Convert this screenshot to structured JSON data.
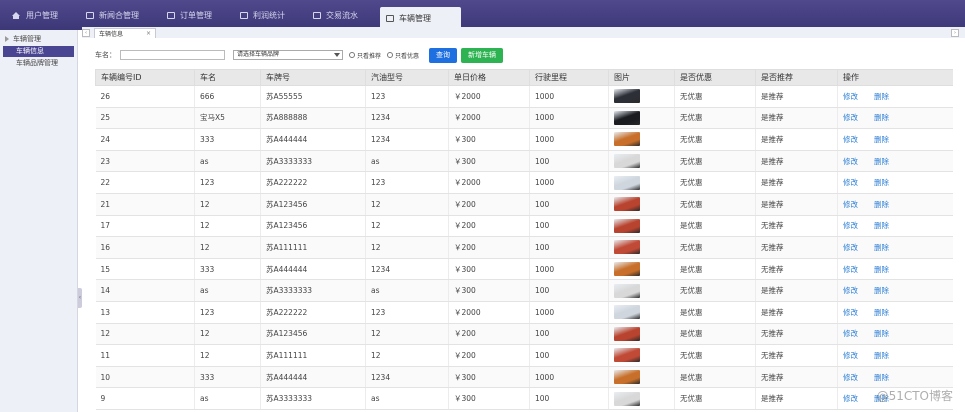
{
  "topnav": [
    {
      "label": "用户管理",
      "icon": "home-icon"
    },
    {
      "label": "新闻合管理",
      "icon": "grid-icon"
    },
    {
      "label": "订单管理",
      "icon": "grid-icon"
    },
    {
      "label": "利润统计",
      "icon": "grid-icon"
    },
    {
      "label": "交易流水",
      "icon": "grid-icon"
    },
    {
      "label": "车辆管理",
      "icon": "grid-icon",
      "active": true
    }
  ],
  "sidebar": {
    "group": "车辆管理",
    "items": [
      {
        "label": "车辆信息",
        "active": true
      },
      {
        "label": "车辆品牌管理"
      }
    ]
  },
  "tabs": {
    "active_tab": "车辆信息",
    "close": "×"
  },
  "toolbar": {
    "name_label": "车名：",
    "brand_select": "请选择车辆品牌",
    "radio1": "只看推荐",
    "radio2": "只看优惠",
    "query_button": "查询",
    "add_button": "新增车辆"
  },
  "table": {
    "headers": [
      "车辆编号ID",
      "车名",
      "车牌号",
      "汽油型号",
      "单日价格",
      "行驶里程",
      "图片",
      "是否优惠",
      "是否推荐",
      "操作"
    ],
    "edit_label": "修改",
    "delete_label": "删除",
    "rows": [
      {
        "id": "26",
        "name": "666",
        "plate": "苏A55555",
        "fuel": "123",
        "price": "￥2000",
        "mileage": "1000",
        "pic": "#2c2f36",
        "discount": "无优惠",
        "recommend": "是推荐"
      },
      {
        "id": "25",
        "name": "宝马X5",
        "plate": "苏A888888",
        "fuel": "1234",
        "price": "￥2000",
        "mileage": "1000",
        "pic": "#1a1c20",
        "discount": "无优惠",
        "recommend": "是推荐"
      },
      {
        "id": "24",
        "name": "333",
        "plate": "苏A444444",
        "fuel": "1234",
        "price": "￥300",
        "mileage": "1000",
        "pic": "#c8702b",
        "discount": "无优惠",
        "recommend": "是推荐"
      },
      {
        "id": "23",
        "name": "as",
        "plate": "苏A3333333",
        "fuel": "as",
        "price": "￥300",
        "mileage": "100",
        "pic": "#d8d8d8",
        "discount": "无优惠",
        "recommend": "是推荐"
      },
      {
        "id": "22",
        "name": "123",
        "plate": "苏A222222",
        "fuel": "123",
        "price": "￥2000",
        "mileage": "1000",
        "pic": "#cfd6de",
        "discount": "无优惠",
        "recommend": "是推荐"
      },
      {
        "id": "21",
        "name": "12",
        "plate": "苏A123456",
        "fuel": "12",
        "price": "￥200",
        "mileage": "100",
        "pic": "#b8432e",
        "discount": "无优惠",
        "recommend": "是推荐"
      },
      {
        "id": "17",
        "name": "12",
        "plate": "苏A123456",
        "fuel": "12",
        "price": "￥200",
        "mileage": "100",
        "pic": "#b8432e",
        "discount": "是优惠",
        "recommend": "无推荐"
      },
      {
        "id": "16",
        "name": "12",
        "plate": "苏A111111",
        "fuel": "12",
        "price": "￥200",
        "mileage": "100",
        "pic": "#c04a36",
        "discount": "无优惠",
        "recommend": "无推荐"
      },
      {
        "id": "15",
        "name": "333",
        "plate": "苏A444444",
        "fuel": "1234",
        "price": "￥300",
        "mileage": "1000",
        "pic": "#c8702b",
        "discount": "是优惠",
        "recommend": "无推荐"
      },
      {
        "id": "14",
        "name": "as",
        "plate": "苏A3333333",
        "fuel": "as",
        "price": "￥300",
        "mileage": "100",
        "pic": "#d8d8d8",
        "discount": "无优惠",
        "recommend": "是推荐"
      },
      {
        "id": "13",
        "name": "123",
        "plate": "苏A222222",
        "fuel": "123",
        "price": "￥2000",
        "mileage": "1000",
        "pic": "#cfd6de",
        "discount": "是优惠",
        "recommend": "是推荐"
      },
      {
        "id": "12",
        "name": "12",
        "plate": "苏A123456",
        "fuel": "12",
        "price": "￥200",
        "mileage": "100",
        "pic": "#b8432e",
        "discount": "是优惠",
        "recommend": "无推荐"
      },
      {
        "id": "11",
        "name": "12",
        "plate": "苏A111111",
        "fuel": "12",
        "price": "￥200",
        "mileage": "100",
        "pic": "#c04a36",
        "discount": "无优惠",
        "recommend": "无推荐"
      },
      {
        "id": "10",
        "name": "333",
        "plate": "苏A444444",
        "fuel": "1234",
        "price": "￥300",
        "mileage": "1000",
        "pic": "#c8702b",
        "discount": "是优惠",
        "recommend": "无推荐"
      },
      {
        "id": "9",
        "name": "as",
        "plate": "苏A3333333",
        "fuel": "as",
        "price": "￥300",
        "mileage": "100",
        "pic": "#d8d8d8",
        "discount": "无优惠",
        "recommend": "是推荐"
      }
    ]
  },
  "watermark": "@51CTO博客"
}
